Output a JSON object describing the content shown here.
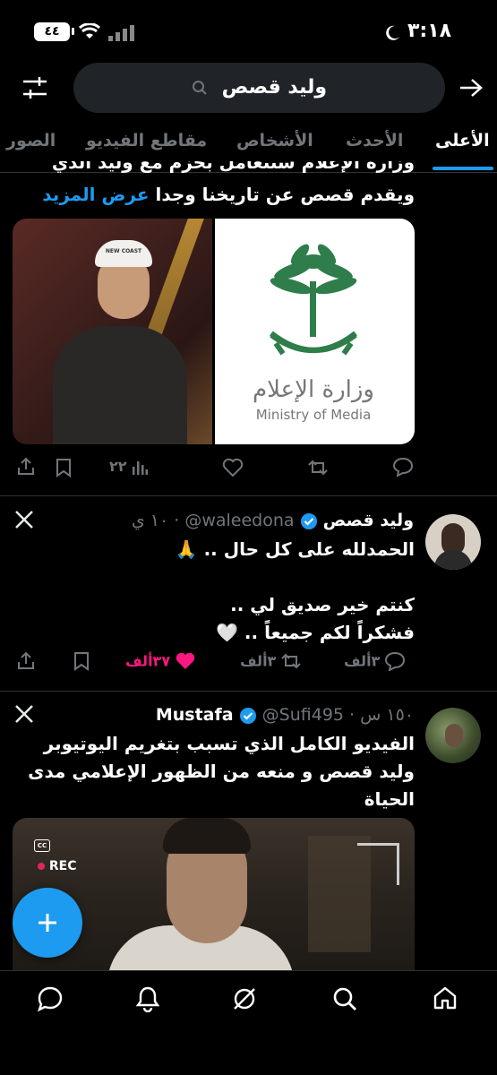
{
  "status_bar": {
    "time": "٣:١٨",
    "battery": "٤٤"
  },
  "header": {
    "search_query": "وليد قصص"
  },
  "tabs": [
    {
      "label": "الأعلى",
      "active": true
    },
    {
      "label": "الأحدث",
      "active": false
    },
    {
      "label": "الأشخاص",
      "active": false
    },
    {
      "label": "مقاطع الفيديو",
      "active": false
    },
    {
      "label": "الصور",
      "active": false
    }
  ],
  "tweets": [
    {
      "text_partial": "وزارة الإعلام ستتعامل بحزم مع وليد الذي",
      "text_line": "ويقدم قصص عن تاريخنا وجدا",
      "show_more": "عرض المزيد",
      "media": {
        "right_logo_ar": "وزارة الإعلام",
        "right_logo_en": "Ministry of Media",
        "cap_text": "NEW COAST"
      },
      "views": "٢٢"
    },
    {
      "author": "وليد قصص",
      "handle": "@waleedona",
      "time": "١٠ ي",
      "lines": [
        "الحمدلله على كل حال .. 🙏",
        "",
        "كنتم خير صديق لي ..",
        "فشكراً لكم جميعاً .. 🤍"
      ],
      "replies": "٣ألف",
      "reposts": "٣ألف",
      "likes": "٣٧ألف",
      "liked": true
    },
    {
      "author": "Mustafa",
      "handle": "@Sufi495",
      "time": "١٥٠ س",
      "lines": [
        "الفيديو الكامل الذي تسبب بتغريم اليوتيوبر",
        "وليد قصص و منعه من الظهور الإعلامي مدى",
        "الحياة"
      ],
      "media": {
        "cc_label": "CC",
        "rec_label": "REC"
      }
    }
  ],
  "colors": {
    "accent": "#1d9bf0",
    "like": "#f91880",
    "background": "#000000",
    "divider": "#2f3336"
  },
  "bottom_nav": [
    "home-icon",
    "search-icon",
    "grok-icon",
    "notifications-icon",
    "messages-icon"
  ]
}
